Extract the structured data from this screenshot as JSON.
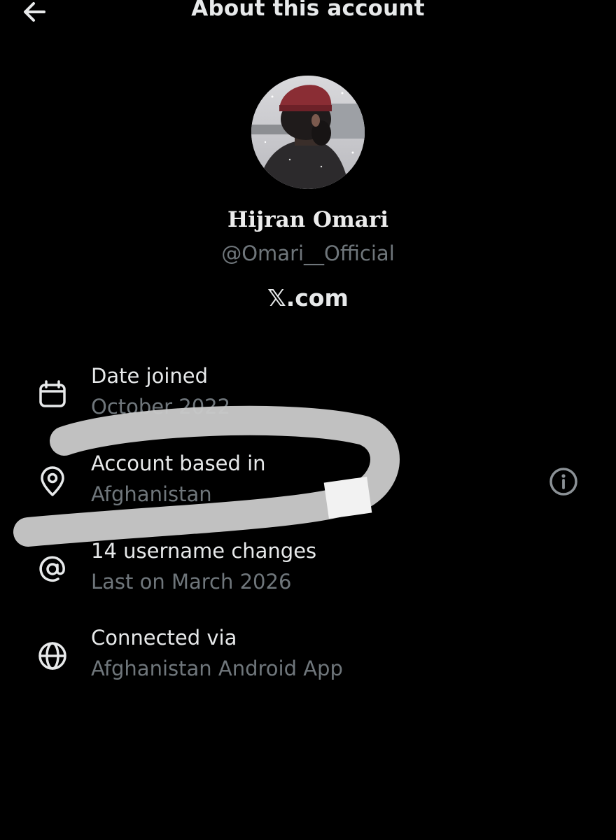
{
  "header": {
    "title": "About this account",
    "back_icon": "arrow-left-icon"
  },
  "profile": {
    "display_name": "Hijran Omari",
    "handle": "@Omari__Official",
    "site": "𝕏.com",
    "avatar_icon": "profile-photo"
  },
  "details": [
    {
      "icon": "calendar-icon",
      "label": "Date joined",
      "value": "October 2022"
    },
    {
      "icon": "location-pin-icon",
      "label": "Account based in",
      "value": "Afghanistan",
      "action_icon": "info-icon"
    },
    {
      "icon": "at-sign-icon",
      "label": "14 username changes",
      "value": "Last on March 2026"
    },
    {
      "icon": "globe-icon",
      "label": "Connected via",
      "value": "Afghanistan Android App"
    }
  ],
  "colors": {
    "background": "#000000",
    "primary_text": "#e7e9ea",
    "secondary_text": "#6f767b",
    "scribble": "#c8c8c8"
  }
}
